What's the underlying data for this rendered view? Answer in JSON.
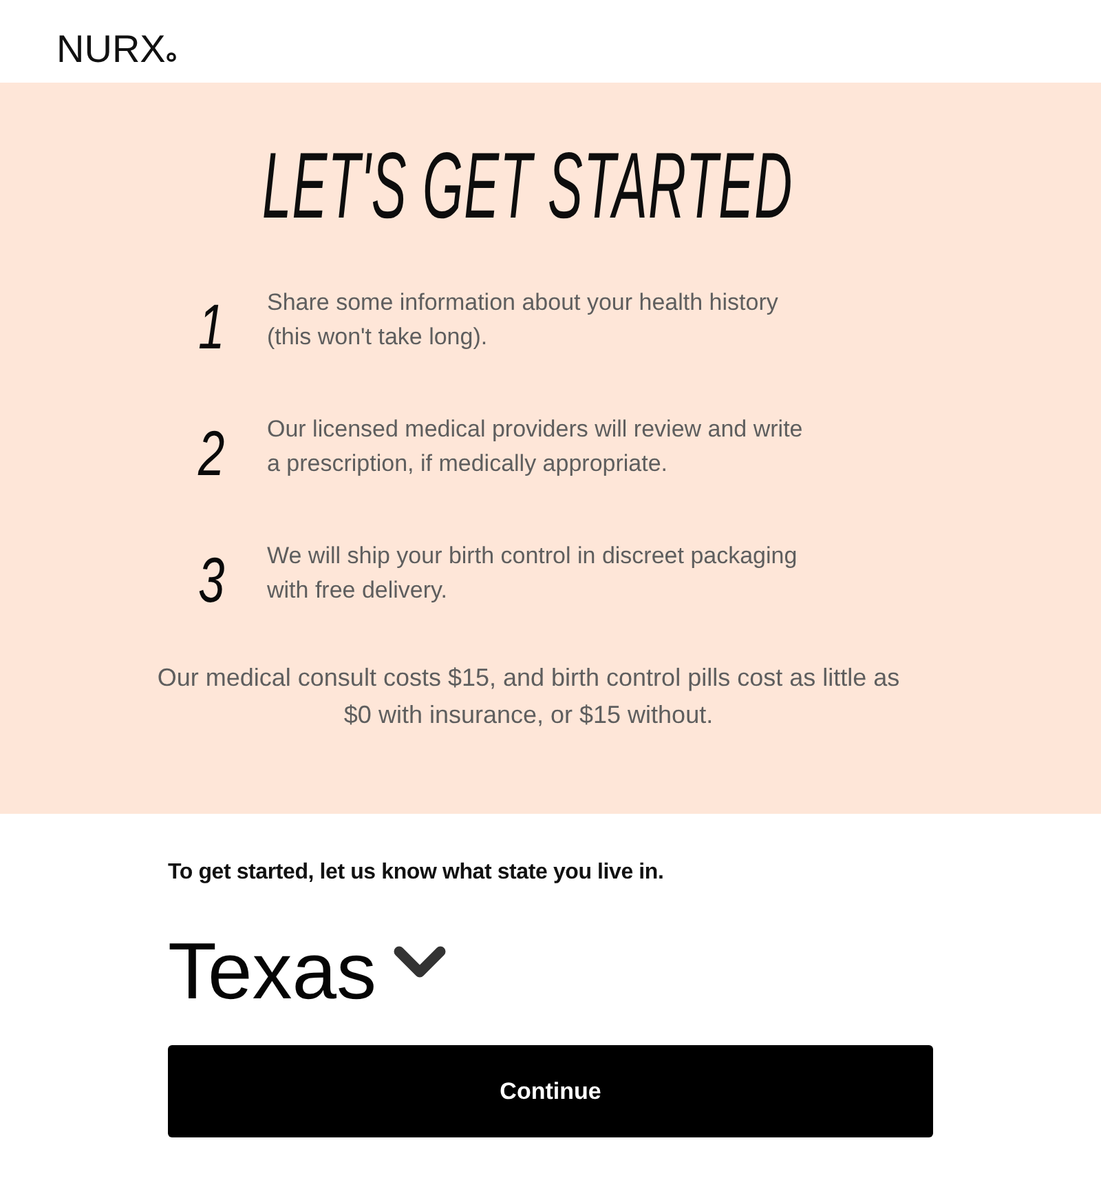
{
  "header": {
    "logo": "NURX"
  },
  "intro": {
    "title": "LET'S GET STARTED",
    "steps": [
      {
        "number": "1",
        "text": "Share some information about your health history (this won't take long)."
      },
      {
        "number": "2",
        "text": "Our licensed medical providers will review and write a prescription, if medically appropriate."
      },
      {
        "number": "3",
        "text": "We will ship your birth control in discreet packaging with free delivery."
      }
    ],
    "pricing_note": "Our medical consult costs $15, and birth control pills cost as little as $0 with insurance, or $15 without."
  },
  "state_form": {
    "prompt": "To get started, let us know what state you live in.",
    "state_select": {
      "value": "Texas"
    },
    "continue_button": "Continue"
  }
}
